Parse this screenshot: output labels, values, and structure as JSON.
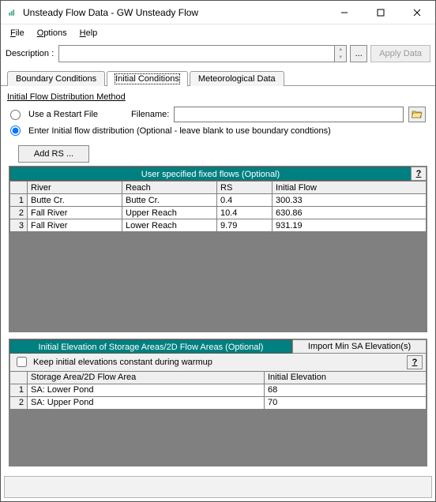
{
  "title": "Unsteady Flow Data - GW Unsteady Flow",
  "menu": {
    "file": "File",
    "options": "Options",
    "help": "Help"
  },
  "description": {
    "label": "Description :",
    "value": "",
    "ellipsis": "...",
    "apply": "Apply Data"
  },
  "tabs": {
    "boundary": "Boundary Conditions",
    "initial": "Initial Conditions",
    "meteo": "Meteorological Data"
  },
  "initial": {
    "section_title": "Initial Flow Distribution Method",
    "use_restart_label": "Use a Restart File",
    "filename_label": "Filename:",
    "filename_value": "",
    "enter_dist_label": "Enter Initial flow distribution (Optional - leave blank to use boundary condtions)",
    "add_rs": "Add RS ...",
    "flows": {
      "title": "User specified fixed flows (Optional)",
      "help": "?",
      "headers": {
        "river": "River",
        "reach": "Reach",
        "rs": "RS",
        "flow": "Initial Flow"
      },
      "rows": [
        {
          "n": "1",
          "river": "Butte Cr.",
          "reach": "Butte Cr.",
          "rs": "0.4",
          "flow": "300.33"
        },
        {
          "n": "2",
          "river": "Fall River",
          "reach": "Upper Reach",
          "rs": "10.4",
          "flow": "630.86"
        },
        {
          "n": "3",
          "river": "Fall River",
          "reach": "Lower Reach",
          "rs": "9.79",
          "flow": "931.19"
        }
      ]
    },
    "storage": {
      "title": "Initial Elevation of Storage Areas/2D Flow Areas (Optional)",
      "import_btn": "Import Min SA Elevation(s)",
      "keep_label": "Keep initial elevations constant during warmup",
      "help": "?",
      "headers": {
        "area": "Storage Area/2D Flow Area",
        "elev": "Initial Elevation"
      },
      "rows": [
        {
          "n": "1",
          "area": "SA: Lower Pond",
          "elev": "68"
        },
        {
          "n": "2",
          "area": "SA: Upper Pond",
          "elev": "70"
        }
      ]
    }
  }
}
